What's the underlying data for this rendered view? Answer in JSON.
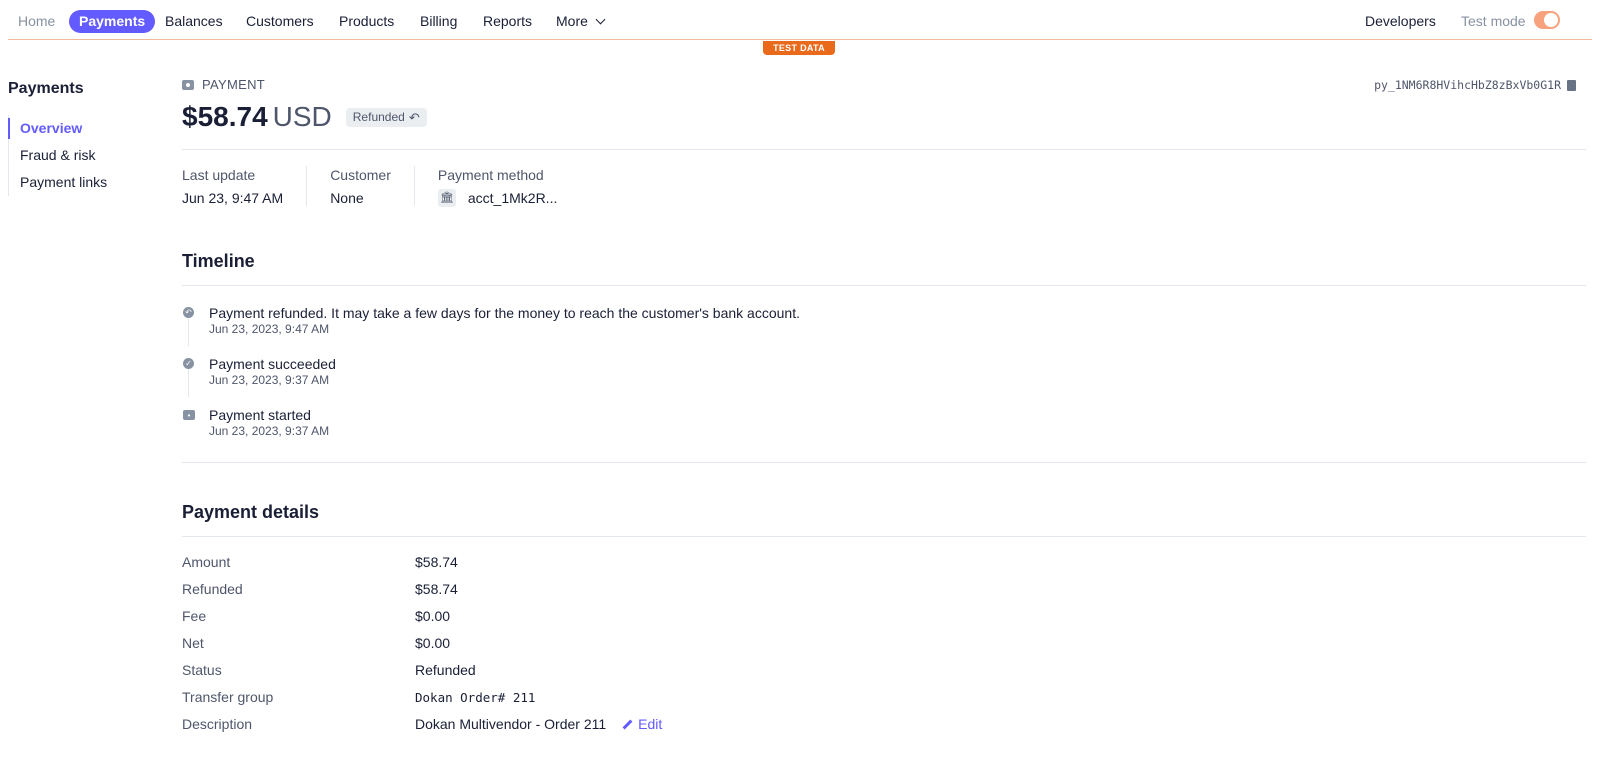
{
  "nav": {
    "items": [
      {
        "label": "Home",
        "state": "muted"
      },
      {
        "label": "Payments",
        "state": "active"
      },
      {
        "label": "Balances",
        "state": "normal"
      },
      {
        "label": "Customers",
        "state": "normal"
      },
      {
        "label": "Products",
        "state": "normal"
      },
      {
        "label": "Billing",
        "state": "normal"
      },
      {
        "label": "Reports",
        "state": "normal"
      },
      {
        "label": "More",
        "state": "normal"
      }
    ],
    "developers": "Developers",
    "test_mode": "Test mode",
    "test_mode_on": true,
    "test_data_badge": "TEST DATA",
    "accent": "#635bff"
  },
  "sidebar": {
    "title": "Payments",
    "items": [
      {
        "label": "Overview",
        "active": true
      },
      {
        "label": "Fraud & risk",
        "active": false
      },
      {
        "label": "Payment links",
        "active": false
      }
    ]
  },
  "payment": {
    "eyebrow": "PAYMENT",
    "id": "py_1NM6R8HVihcHbZ8zBxVb0G1R",
    "amount": "$58.74",
    "currency": "USD",
    "status_badge": "Refunded",
    "meta": {
      "last_update_label": "Last update",
      "last_update": "Jun 23, 9:47 AM",
      "customer_label": "Customer",
      "customer": "None",
      "method_label": "Payment method",
      "method": "acct_1Mk2R..."
    }
  },
  "timeline": {
    "title": "Timeline",
    "events": [
      {
        "text": "Payment refunded. It may take a few days for the money to reach the customer's bank account.",
        "time": "Jun 23, 2023, 9:47 AM",
        "icon": "refund-icon"
      },
      {
        "text": "Payment succeeded",
        "time": "Jun 23, 2023, 9:37 AM",
        "icon": "check-circle-icon"
      },
      {
        "text": "Payment started",
        "time": "Jun 23, 2023, 9:37 AM",
        "icon": "payment-icon"
      }
    ]
  },
  "details": {
    "title": "Payment details",
    "rows": [
      {
        "key": "Amount",
        "value": "$58.74"
      },
      {
        "key": "Refunded",
        "value": "$58.74"
      },
      {
        "key": "Fee",
        "value": "$0.00"
      },
      {
        "key": "Net",
        "value": "$0.00"
      },
      {
        "key": "Status",
        "value": "Refunded"
      },
      {
        "key": "Transfer group",
        "value": "Dokan Order# 211"
      },
      {
        "key": "Description",
        "value": "Dokan Multivendor - Order 211"
      }
    ],
    "edit_label": "Edit"
  }
}
